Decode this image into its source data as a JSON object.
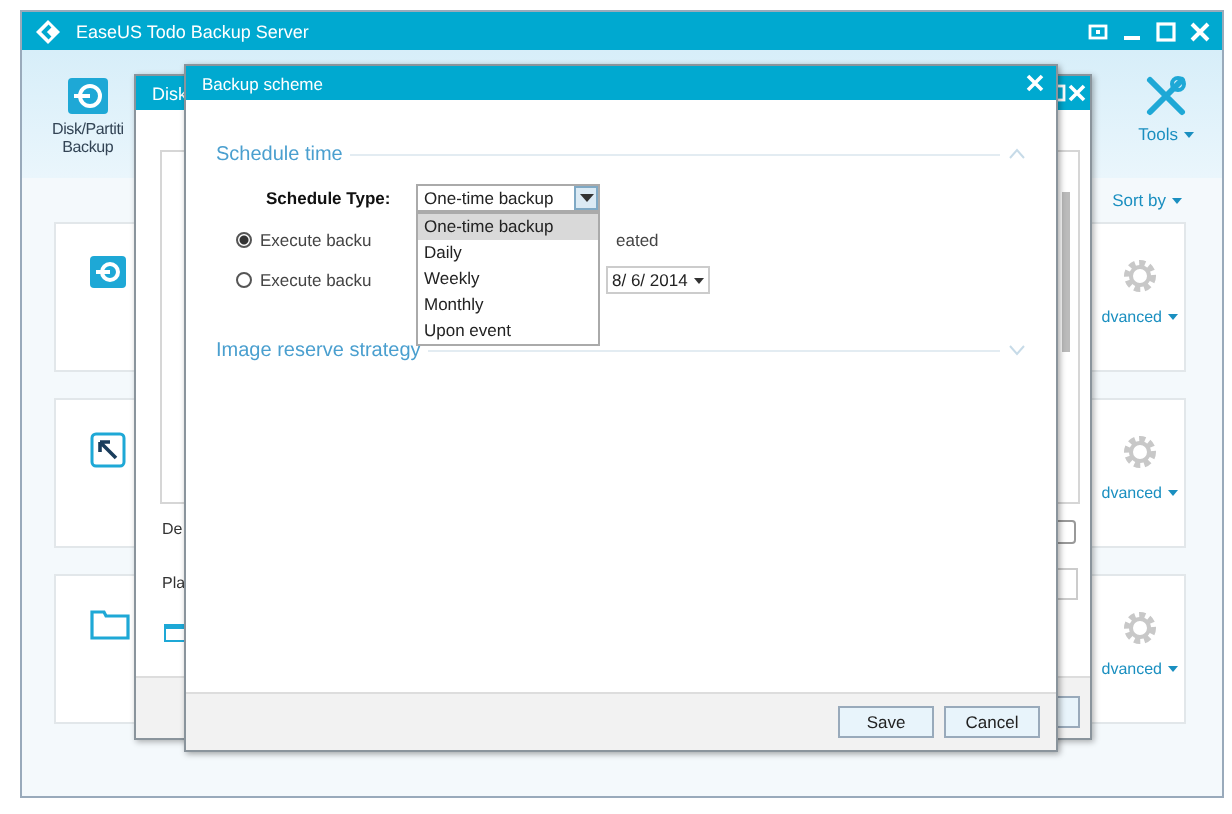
{
  "window": {
    "title": "EaseUS Todo Backup Server"
  },
  "toolbar": {
    "left_item": {
      "lines": [
        "Disk/Partiti",
        "Backup"
      ]
    },
    "tools": {
      "label": "Tools"
    }
  },
  "sort": {
    "label": "Sort by"
  },
  "cards": [
    {
      "kind": "disk",
      "action": "dvanced"
    },
    {
      "kind": "pointer",
      "action": "dvanced"
    },
    {
      "kind": "folder",
      "action": "dvanced"
    }
  ],
  "back_dialog": {
    "title": "Disk",
    "labels": [
      "De",
      "Pla"
    ]
  },
  "dialog": {
    "title": "Backup scheme",
    "sections": [
      {
        "title": "Schedule time",
        "expanded": true
      },
      {
        "title": "Image reserve strategy",
        "expanded": false
      }
    ],
    "schedule_type": {
      "label": "Schedule Type:",
      "value": "One-time backup",
      "options": [
        {
          "label": "One-time backup",
          "selected": true
        },
        {
          "label": "Daily",
          "selected": false
        },
        {
          "label": "Weekly",
          "selected": false
        },
        {
          "label": "Monthly",
          "selected": false
        },
        {
          "label": "Upon event",
          "selected": false
        }
      ]
    },
    "runs": [
      {
        "kind": "repeat",
        "selected": true,
        "text": "Execute backu",
        "after": "eated"
      },
      {
        "kind": "date",
        "selected": false,
        "text": "Execute backu",
        "date": "8/ 6/ 2014"
      }
    ],
    "buttons": [
      "Save",
      "Cancel"
    ]
  }
}
